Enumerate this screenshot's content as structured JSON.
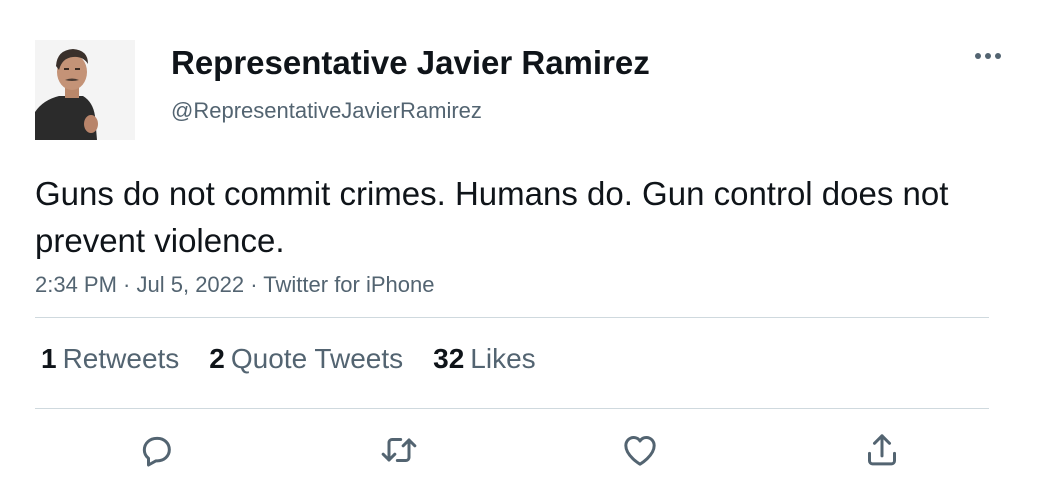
{
  "author": {
    "display_name": "Representative Javier Ramirez",
    "handle": "@RepresentativeJavierRamirez"
  },
  "tweet": {
    "text": "Guns do not commit crimes. Humans do. Gun control does not prevent violence.",
    "time": "2:34 PM",
    "date": "Jul 5, 2022",
    "source": "Twitter for iPhone",
    "separator": " · "
  },
  "stats": {
    "retweets": {
      "count": "1",
      "label": "Retweets"
    },
    "quotes": {
      "count": "2",
      "label": "Quote Tweets"
    },
    "likes": {
      "count": "32",
      "label": "Likes"
    }
  },
  "icons": {
    "more": "more-icon",
    "reply": "reply-icon",
    "retweet": "retweet-icon",
    "like": "heart-icon",
    "share": "share-icon"
  },
  "colors": {
    "text": "#0f1419",
    "secondary": "#536471",
    "divider": "#cfd9de"
  }
}
